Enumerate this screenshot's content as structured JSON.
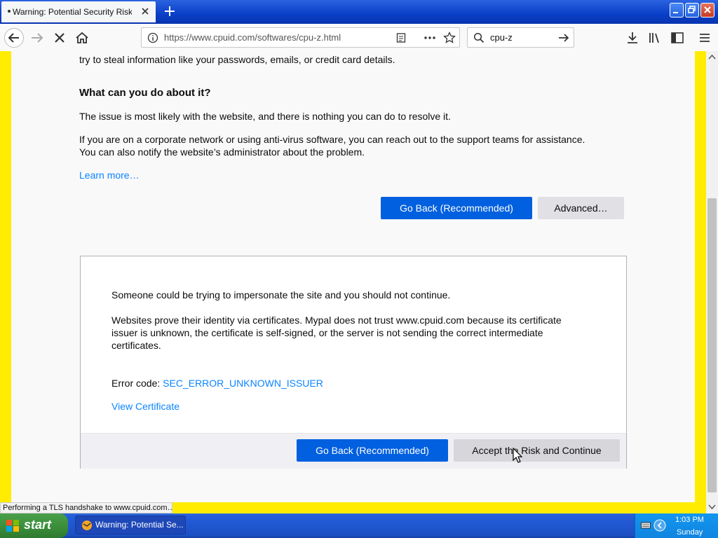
{
  "tab": {
    "title": "Warning: Potential Security Risk Ahead"
  },
  "toolbar": {
    "url": "https://www.cpuid.com/softwares/cpu-z.html",
    "search_query": "cpu-z"
  },
  "page": {
    "partial_line": "try to steal information like your passwords, emails, or credit card details.",
    "heading": "What can you do about it?",
    "para1": "The issue is most likely with the website, and there is nothing you can do to resolve it.",
    "para2_line1": "If you are on a corporate network or using anti-virus software, you can reach out to the support teams for assistance.",
    "para2_line2": "You can also notify the website’s administrator about the problem.",
    "learn_more": "Learn more…",
    "go_back_label": "Go Back (Recommended)",
    "advanced_label": "Advanced…"
  },
  "advanced": {
    "line1": "Someone could be trying to impersonate the site and you should not continue.",
    "cert_line1": "Websites prove their identity via certificates. Mypal does not trust www.cpuid.com because its certificate",
    "cert_line2": "issuer is unknown, the certificate is self-signed, or the server is not sending the correct intermediate",
    "cert_line3": "certificates.",
    "error_code_label": "Error code: ",
    "error_code": "SEC_ERROR_UNKNOWN_ISSUER",
    "view_certificate": "View Certificate",
    "go_back_label": "Go Back (Recommended)",
    "accept_label": "Accept the Risk and Continue"
  },
  "status_text": "Performing a TLS handshake to www.cpuid.com…",
  "taskbar": {
    "start_label": "start",
    "task_label": "Warning: Potential Se...",
    "clock_time": "1:03 PM",
    "clock_day": "Sunday"
  },
  "colors": {
    "accent": "#0060df",
    "link": "#0a84ff",
    "highlight": "#ffec00"
  }
}
